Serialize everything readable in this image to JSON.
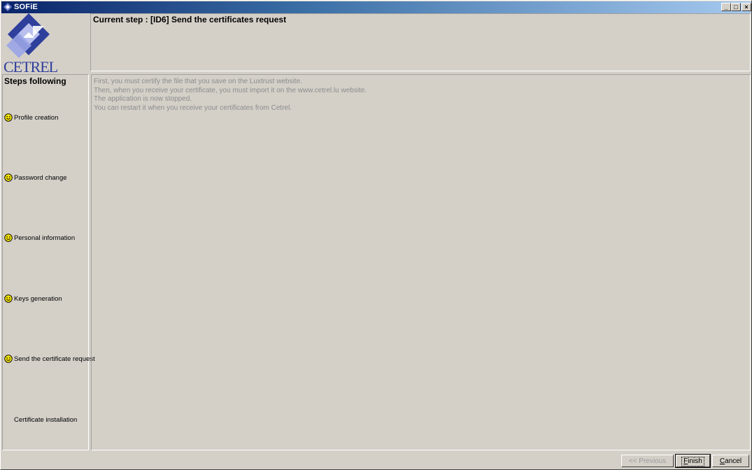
{
  "window": {
    "title": "SOFiE"
  },
  "logo": {
    "text": "CETREL"
  },
  "header": {
    "current_step": "Current step :  [ID6]  Send the certificates request"
  },
  "steps": {
    "heading": "Steps following",
    "items": [
      {
        "label": "Profile creation",
        "icon": "smile-icon"
      },
      {
        "label": "Password change",
        "icon": "smile-icon"
      },
      {
        "label": "Personal information",
        "icon": "smile-icon"
      },
      {
        "label": "Keys generation",
        "icon": "smile-icon"
      },
      {
        "label": "Send the certificate request",
        "icon": "smile-icon"
      },
      {
        "label": "Certificate installation",
        "icon": ""
      }
    ]
  },
  "content": {
    "lines": [
      "First, you must certify the file that you save on the Luxtrust website.",
      "Then, when you receive your certificate, you must import it on the www.cetrel.lu website.",
      "The application is now stopped.",
      "You can restart it when you receive your certificates from Cetrel."
    ]
  },
  "buttons": {
    "previous": "<< Previous",
    "finish_first": "F",
    "finish_rest": "inish",
    "cancel_first": "C",
    "cancel_rest": "ancel"
  },
  "colors": {
    "accent": "#0a246a",
    "smile": "#f2e200",
    "logo_blue": "#2f3f9c"
  }
}
